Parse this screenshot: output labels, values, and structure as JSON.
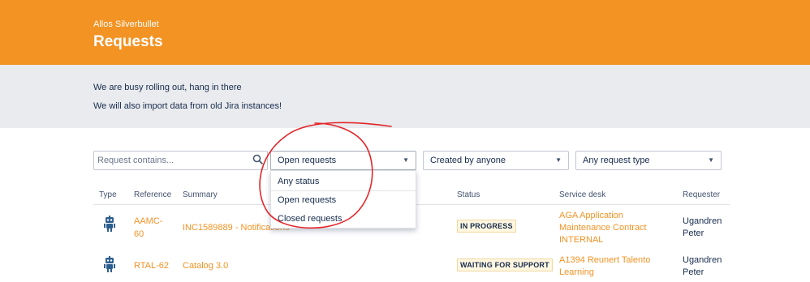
{
  "header": {
    "org_name": "Allos Silverbullet",
    "title": "Requests"
  },
  "banner": {
    "line1": "We are busy rolling out, hang in there",
    "line2": "We will also import data from old Jira instances!"
  },
  "filters": {
    "search_placeholder": "Request contains...",
    "status_selected": "Open requests",
    "creator_selected": "Created by anyone",
    "type_selected": "Any request type"
  },
  "status_dropdown": {
    "options": [
      "Any status",
      "Open requests",
      "Closed requests"
    ]
  },
  "table": {
    "columns": [
      "Type",
      "Reference",
      "Summary",
      "Status",
      "Service desk",
      "Requester"
    ],
    "rows": [
      {
        "type_icon": "robot-icon",
        "reference": "AAMC-60",
        "reference_line1": "AAMC-",
        "reference_line2": "60",
        "summary": "INC1589889 - Notifications",
        "status": "IN PROGRESS",
        "service_desk_line1": "AGA Application",
        "service_desk_line2": "Maintenance Contract",
        "service_desk_line3": "INTERNAL",
        "requester_line1": "Ugandren",
        "requester_line2": "Peter"
      },
      {
        "type_icon": "robot-icon",
        "reference": "RTAL-62",
        "summary": "Catalog 3.0",
        "status": "WAITING FOR SUPPORT",
        "service_desk_line1": "A1394 Reunert Talento",
        "service_desk_line2": "Learning",
        "requester_line1": "Ugandren",
        "requester_line2": "Peter"
      }
    ]
  },
  "colors": {
    "header_bg": "#f39324",
    "banner_bg": "#e9ebee",
    "link": "#f39324",
    "annotation": "#e3262a"
  }
}
